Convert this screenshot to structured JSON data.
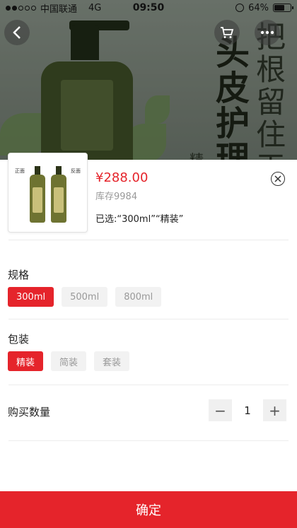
{
  "status_bar": {
    "carrier": "中国联通",
    "network": "4G",
    "time": "09:50",
    "battery": "64%"
  },
  "background": {
    "text_bold": "头皮护理",
    "text_thin": "把根留住天",
    "text_small": "精"
  },
  "sheet": {
    "thumb_front": "正面",
    "thumb_back": "反面",
    "price": "¥288.00",
    "stock": "库存9984",
    "selected_text": "已选:“300ml”“精装”",
    "spec": {
      "title": "规格",
      "options": [
        "300ml",
        "500ml",
        "800ml"
      ],
      "selected": "300ml"
    },
    "package": {
      "title": "包装",
      "options": [
        "精装",
        "简装",
        "套装"
      ],
      "selected": "精装"
    },
    "quantity": {
      "label": "购买数量",
      "value": "1",
      "minus": "−",
      "plus": "+"
    },
    "confirm_label": "确定"
  },
  "colors": {
    "accent": "#e5242b"
  }
}
